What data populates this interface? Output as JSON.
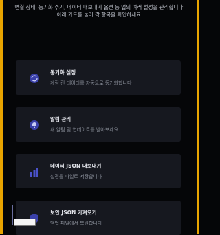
{
  "intro": {
    "text": "연결 상태, 동기화 주기, 데이터 내보내기 옵션 등 앱의 여러 설정을 관리합니다. 아래 카드를 눌러 각 항목을 확인하세요."
  },
  "cards": [
    {
      "title": "동기화 설정",
      "desc": "계정 간 데이터를 자동으로 동기화합니다",
      "icon": "sync-icon"
    },
    {
      "title": "알림 관리",
      "desc": "새 알림 및 업데이트를 받아보세요",
      "icon": "bell-icon"
    },
    {
      "title": "데이터 JSON 내보내기",
      "desc": "설정을 파일로 저장합니다",
      "icon": "chart-icon"
    },
    {
      "title": "보안 JSON 가져오기",
      "desc": "백업 파일에서 복원합니다",
      "icon": "shield-icon"
    }
  ],
  "colors": {
    "accent": "#4a52c9",
    "edge": "#e8a400",
    "card_bg": "#16181f"
  }
}
